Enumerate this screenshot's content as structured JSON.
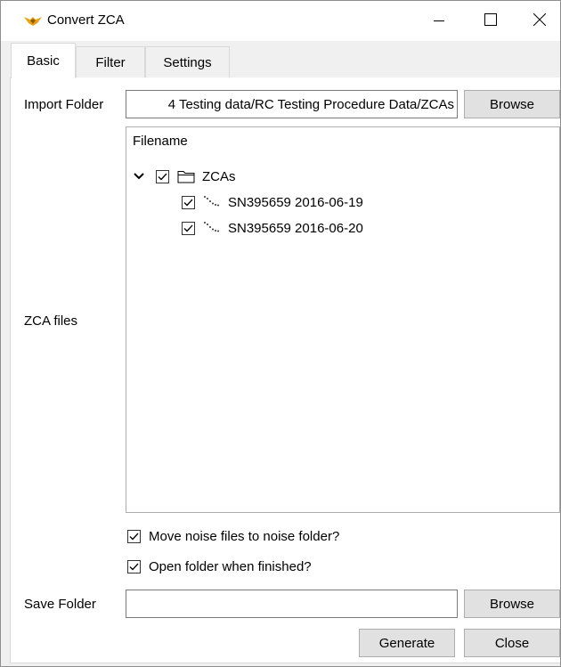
{
  "window": {
    "title": "Convert ZCA",
    "controls": {
      "minimize": "minimize-icon",
      "maximize": "maximize-icon",
      "close": "close-icon"
    }
  },
  "tabs": [
    {
      "label": "Basic",
      "active": true
    },
    {
      "label": "Filter",
      "active": false
    },
    {
      "label": "Settings",
      "active": false
    }
  ],
  "basic": {
    "import_folder": {
      "label": "Import Folder",
      "value": "4 Testing data/RC Testing Procedure Data/ZCAs",
      "browse_label": "Browse"
    },
    "zca_files": {
      "label": "ZCA files",
      "column_header": "Filename",
      "root": {
        "name": "ZCAs",
        "checked": true,
        "expanded": true,
        "icon": "folder-icon"
      },
      "files": [
        {
          "name": "SN395659 2016-06-19",
          "checked": true,
          "icon": "zca-file-icon"
        },
        {
          "name": "SN395659 2016-06-20",
          "checked": true,
          "icon": "zca-file-icon"
        }
      ]
    },
    "options": {
      "move_noise": {
        "label": "Move noise files to noise folder?",
        "checked": true
      },
      "open_folder": {
        "label": "Open folder when finished?",
        "checked": true
      }
    },
    "save_folder": {
      "label": "Save Folder",
      "value": "",
      "browse_label": "Browse"
    },
    "actions": {
      "generate_label": "Generate",
      "close_label": "Close"
    }
  },
  "colors": {
    "window_bg": "#f0f0f0",
    "panel_bg": "#ffffff",
    "button_bg": "#e1e1e1",
    "icon_accent": "#e8a317"
  }
}
